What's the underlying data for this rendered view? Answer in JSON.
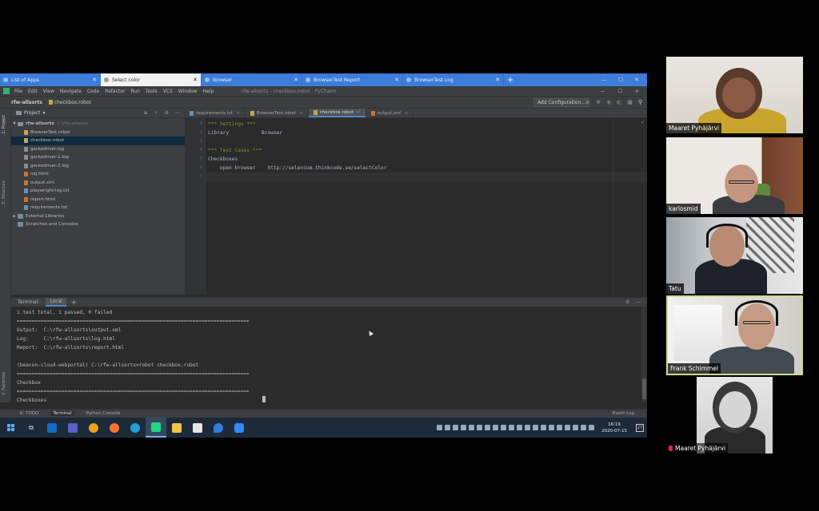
{
  "browser": {
    "tabs": [
      {
        "label": "List of Apps",
        "active": false
      },
      {
        "label": "Select color",
        "active": true
      },
      {
        "label": "Browser",
        "active": false
      },
      {
        "label": "BrowserTest Report",
        "active": false
      },
      {
        "label": "BrowserTest Log",
        "active": false
      }
    ]
  },
  "ide": {
    "menu": [
      "File",
      "Edit",
      "View",
      "Navigate",
      "Code",
      "Refactor",
      "Run",
      "Tools",
      "VCS",
      "Window",
      "Help"
    ],
    "window_title": "rfw-allsorts - checkbox.robot - PyCharm",
    "breadcrumb": {
      "project": "rfw-allsorts",
      "file": "checkbox.robot"
    },
    "add_configuration": "Add Configuration...",
    "left_strip": {
      "project": "1: Project",
      "structure": "Z: Structure",
      "favorites": "2: Favorites"
    },
    "project_panel": {
      "title": "Project",
      "root": "rfw-allsorts",
      "root_path": "C:\\rfw-allsorts",
      "files": [
        {
          "name": "BrowserTest.robot",
          "type": "robot"
        },
        {
          "name": "checkbox.robot",
          "type": "robot",
          "selected": true
        },
        {
          "name": "geckodriver.log",
          "type": "log"
        },
        {
          "name": "geckodriver-1.log",
          "type": "log"
        },
        {
          "name": "geckodriver-2.log",
          "type": "log"
        },
        {
          "name": "log.html",
          "type": "html"
        },
        {
          "name": "output.xml",
          "type": "xml"
        },
        {
          "name": "playwright-log.txt",
          "type": "txt"
        },
        {
          "name": "report.html",
          "type": "html"
        },
        {
          "name": "requirements.txt",
          "type": "txt"
        }
      ],
      "external_libraries": "External Libraries",
      "scratches": "Scratches and Consoles"
    },
    "editor_tabs": [
      {
        "label": "requirements.txt",
        "active": false
      },
      {
        "label": "BrowserTest.robot",
        "active": false
      },
      {
        "label": "checkbox.robot",
        "active": true
      },
      {
        "label": "output.xml",
        "active": false
      }
    ],
    "code_lines": [
      "*** Settings ***",
      "Library           Browser",
      "",
      "*** Test Cases ***",
      "Checkboxes",
      "    open browser    http://selenium.thinkcode.se/selectColor",
      ""
    ],
    "line_numbers": [
      "1",
      "2",
      "3",
      "4",
      "5",
      "6",
      "7"
    ],
    "terminal": {
      "title": "Terminal:",
      "tab": "Local",
      "lines": [
        "1 test total, 1 passed, 0 failed",
        "==============================================================================",
        "Output:  C:\\rfw-allsorts\\output.xml",
        "Log:     C:\\rfw-allsorts\\log.html",
        "Report:  C:\\rfw-allsorts\\report.html",
        "",
        "(beacon-cloud-webportal) C:\\rfw-allsorts>robot checkbox.robot",
        "==============================================================================",
        "Checkbox",
        "==============================================================================",
        "Checkboxes"
      ]
    },
    "bottom_tools": [
      "6: TODO",
      "Terminal",
      "Python Console"
    ],
    "event_log": "Event Log"
  },
  "taskbar": {
    "time": "16:19",
    "date": "2020-07-15",
    "notifications": "27"
  },
  "participants": [
    {
      "name": "Maaret Pyhäjärvi",
      "muted": false,
      "highlighted": false
    },
    {
      "name": "karlosmid",
      "muted": false,
      "highlighted": false
    },
    {
      "name": "Tatu",
      "muted": false,
      "highlighted": false
    },
    {
      "name": "Frank Schimmel",
      "muted": false,
      "highlighted": true
    },
    {
      "name": "Maaret Pyhäjärvi",
      "muted": true,
      "highlighted": false
    }
  ]
}
